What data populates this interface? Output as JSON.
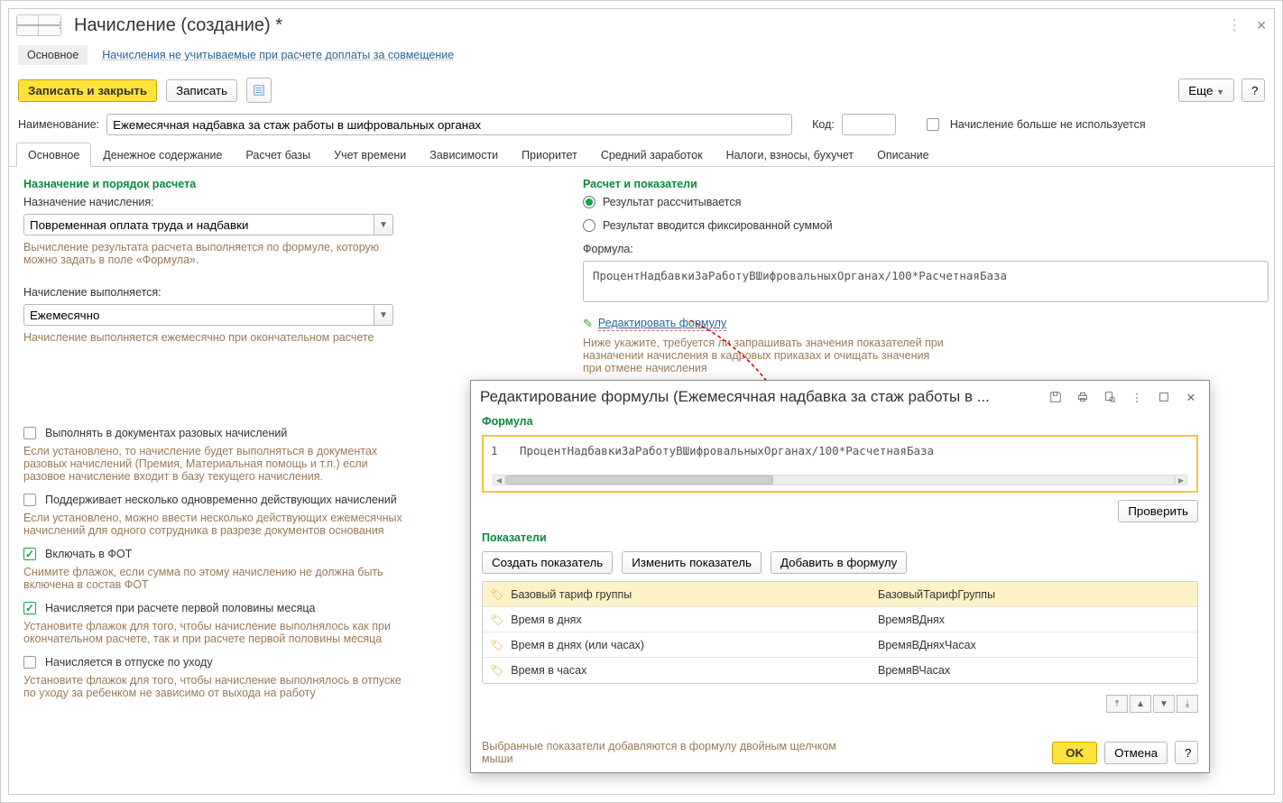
{
  "header": {
    "title": "Начисление (создание) *"
  },
  "subnav": {
    "active": "Основное",
    "link": "Начисления не учитываемые при расчете доплаты за совмещение"
  },
  "toolbar": {
    "saveClose": "Записать и закрыть",
    "save": "Записать",
    "more": "Еще",
    "help": "?"
  },
  "nameRow": {
    "nameLabel": "Наименование:",
    "nameValue": "Ежемесячная надбавка за стаж работы в шифровальных органах",
    "codeLabel": "Код:",
    "codeValue": "",
    "unusedLabel": "Начисление больше не используется"
  },
  "tabs": [
    "Основное",
    "Денежное содержание",
    "Расчет базы",
    "Учет времени",
    "Зависимости",
    "Приоритет",
    "Средний заработок",
    "Налоги, взносы, бухучет",
    "Описание"
  ],
  "left": {
    "sectionTitle": "Назначение и порядок расчета",
    "purposeLabel": "Назначение начисления:",
    "purposeValue": "Повременная оплата труда и надбавки",
    "purposeHint": "Вычисление результата расчета выполняется по формуле, которую можно задать в поле «Формула».",
    "execLabel": "Начисление выполняется:",
    "execValue": "Ежемесячно",
    "execHint": "Начисление выполняется ежемесячно при окончательном расчете",
    "c1": "Выполнять в документах разовых начислений",
    "c1hint": "Если установлено, то начисление будет выполняться в документах разовых начислений (Премия, Материальная помощь и т.п.) если разовое начисление входит в базу текущего начисления.",
    "c2": "Поддерживает несколько одновременно действующих начислений",
    "c2hint": "Если установлено, можно ввести несколько действующих ежемесячных начислений для одного сотрудника в разрезе документов основания",
    "c3": "Включать в ФОТ",
    "c3hint": "Снимите флажок, если сумма по этому начислению не должна быть включена в состав ФОТ",
    "c4": "Начисляется при расчете первой половины месяца",
    "c4hint": "Установите флажок для того, чтобы начисление выполнялось как при окончательном расчете, так и при расчете первой половины месяца",
    "c5": "Начисляется в отпуске по уходу",
    "c5hint": "Установите флажок для того, чтобы начисление выполнялось в отпуске по уходу за ребенком не зависимо от выхода на работу"
  },
  "right": {
    "sectionTitle": "Расчет и показатели",
    "r1": "Результат рассчитывается",
    "r2": "Результат вводится фиксированной суммой",
    "formulaLabel": "Формула:",
    "formulaText": "ПроцентНадбавкиЗаРаботуВШифровальныхОрганах/100*РасчетнаяБаза",
    "editLink": "Редактировать формулу",
    "belowHint": "Ниже укажите, требуется ли запрашивать значения показателей при назначении начисления в кадровых приказах и очищать значения при отмене начисления"
  },
  "modal": {
    "title": "Редактирование формулы (Ежемесячная надбавка за стаж работы в ...",
    "formulaLabel": "Формула",
    "formulaLine": "1",
    "formulaText": "ПроцентНадбавкиЗаРаботуВШифровальныхОрганах/100*РасчетнаяБаза",
    "checkBtn": "Проверить",
    "indicatorsLabel": "Показатели",
    "createBtn": "Создать показатель",
    "editBtn": "Изменить показатель",
    "addBtn": "Добавить в формулу",
    "rows": [
      {
        "name": "Базовый тариф группы",
        "id": "БазовыйТарифГруппы"
      },
      {
        "name": "Время в днях",
        "id": "ВремяВДнях"
      },
      {
        "name": "Время в днях (или часах)",
        "id": "ВремяВДняхЧасах"
      },
      {
        "name": "Время в часах",
        "id": "ВремяВЧасах"
      }
    ],
    "bottomHint": "Выбранные показатели добавляются в формулу двойным щелчком мыши",
    "ok": "OK",
    "cancel": "Отмена",
    "help": "?"
  }
}
